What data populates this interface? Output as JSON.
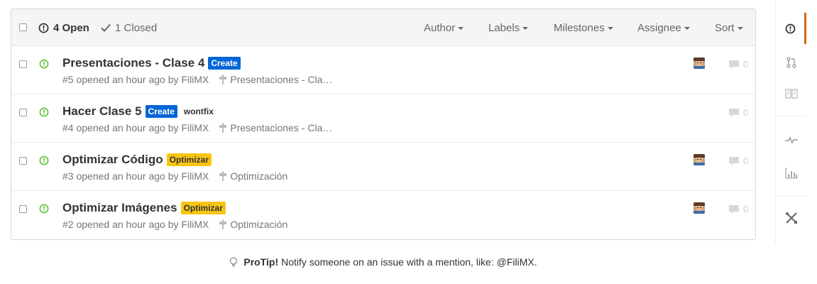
{
  "header": {
    "open_label": "4 Open",
    "closed_label": "1 Closed",
    "filters": [
      "Author",
      "Labels",
      "Milestones",
      "Assignee",
      "Sort"
    ]
  },
  "issues": [
    {
      "title": "Presentaciones - Clase 4",
      "labels": [
        {
          "text": "Create",
          "bg": "#0366d6",
          "fg": "#ffffff"
        }
      ],
      "number": "#5",
      "opened_text": "opened an hour ago by",
      "author": "FiliMX",
      "milestone": "Presentaciones - Cla…",
      "has_assignee": true,
      "comments": "0"
    },
    {
      "title": "Hacer Clase 5",
      "labels": [
        {
          "text": "Create",
          "bg": "#0366d6",
          "fg": "#ffffff"
        },
        {
          "text": "wontfix",
          "bg": "#ffffff",
          "fg": "#333333"
        }
      ],
      "number": "#4",
      "opened_text": "opened an hour ago by",
      "author": "FiliMX",
      "milestone": "Presentaciones - Cla…",
      "has_assignee": false,
      "comments": "0"
    },
    {
      "title": "Optimizar Código",
      "labels": [
        {
          "text": "Optimizar",
          "bg": "#f9c513",
          "fg": "#333333"
        }
      ],
      "number": "#3",
      "opened_text": "opened an hour ago by",
      "author": "FiliMX",
      "milestone": "Optimización",
      "has_assignee": true,
      "comments": "0"
    },
    {
      "title": "Optimizar Imágenes",
      "labels": [
        {
          "text": "Optimizar",
          "bg": "#f9c513",
          "fg": "#333333"
        }
      ],
      "number": "#2",
      "opened_text": "opened an hour ago by",
      "author": "FiliMX",
      "milestone": "Optimización",
      "has_assignee": true,
      "comments": "0"
    }
  ],
  "right_nav": [
    "issues-icon",
    "pull-request-icon",
    "wiki-book-icon",
    "pulse-icon",
    "graphs-icon",
    "settings-tools-icon"
  ],
  "protip": {
    "bold": "ProTip!",
    "text": "Notify someone on an issue with a mention, like: @FiliMX."
  },
  "colors": {
    "open_green": "#6cc644",
    "active_orange": "#d26911",
    "create_label": "#0366d6",
    "optimizar_label": "#f9c513"
  }
}
